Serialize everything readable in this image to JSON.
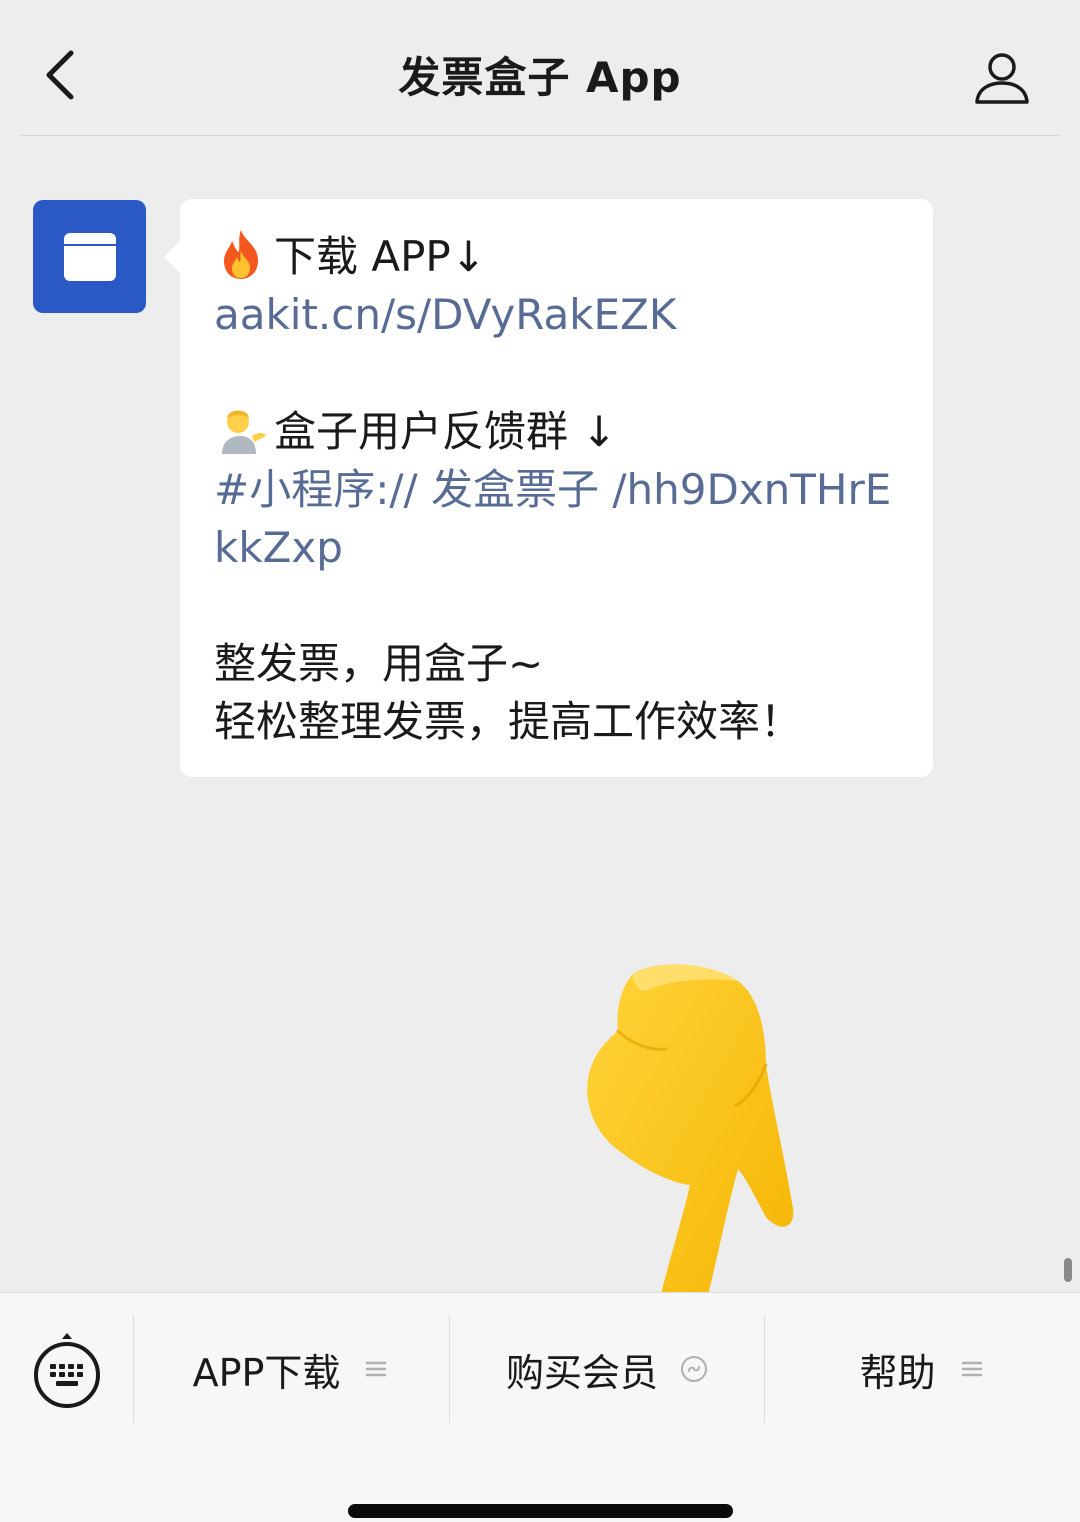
{
  "header": {
    "title": "发票盒子 App",
    "back_icon": "chevron-left-icon",
    "profile_icon": "person-icon"
  },
  "message": {
    "avatar_icon": "box-icon",
    "download_emoji": "fire-emoji",
    "download_label": "下载 APP↓",
    "download_link": "aakit.cn/s/DVyRakEZK",
    "group_emoji": "person-tipping-hand-emoji",
    "group_label": "盒子用户反馈群 ↓",
    "miniprogram_link_line1": "#小程序:// 发盒票子 /hh9DxnTHrE",
    "miniprogram_link_line2": "kkZxp",
    "slogan_line1": "整发票，用盒子~",
    "slogan_line2": "轻松整理发票，提高工作效率！"
  },
  "overlay": {
    "pointing_icon": "pointing-down-hand-emoji"
  },
  "menu": {
    "keyboard_icon": "keyboard-icon",
    "items": [
      {
        "label": "APP下载",
        "icon": "menu-lines-icon"
      },
      {
        "label": "购买会员",
        "icon": "mini-program-icon"
      },
      {
        "label": "帮助",
        "icon": "menu-lines-icon"
      }
    ]
  },
  "colors": {
    "background": "#ededed",
    "bubble": "#ffffff",
    "link": "#576b95",
    "avatar": "#2a58c4"
  }
}
